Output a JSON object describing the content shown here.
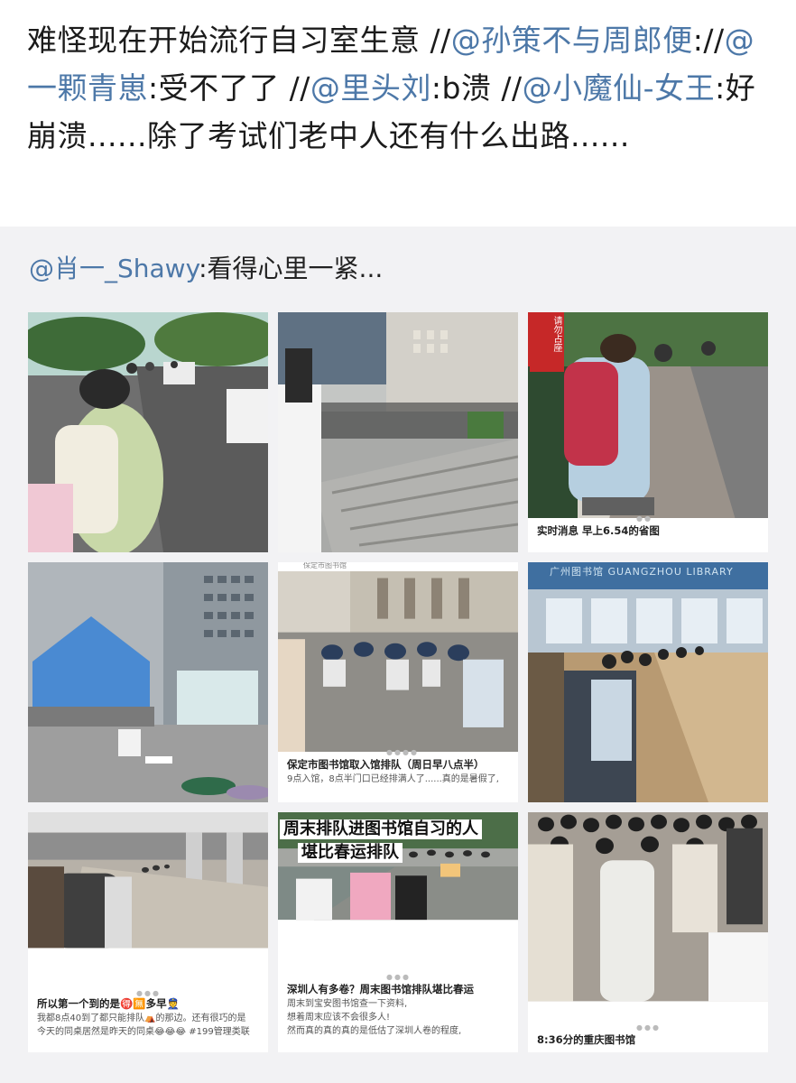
{
  "post": {
    "segments": [
      {
        "text": "难怪现在开始流行自习室生意 //",
        "mention": false
      },
      {
        "text": "@孙策不与周郎便",
        "mention": true
      },
      {
        "text": "://",
        "mention": false
      },
      {
        "text": "@一颗青崽",
        "mention": true
      },
      {
        "text": ":受不了了 //",
        "mention": false
      },
      {
        "text": "@里头刘",
        "mention": true
      },
      {
        "text": ":b溃 //",
        "mention": false
      },
      {
        "text": "@小魔仙-女王",
        "mention": true
      },
      {
        "text": ":好崩溃......除了考试们老中人还有什么出路......",
        "mention": false
      }
    ]
  },
  "repost": {
    "author": "@肖一_Shawy",
    "text": ":看得心里一紧..."
  },
  "photos": [
    {
      "id": "p1"
    },
    {
      "id": "p2"
    },
    {
      "id": "p3",
      "caption_title": "实时消息 早上6.54的省图",
      "caption_body": "",
      "banner": "请勿占座"
    },
    {
      "id": "p4"
    },
    {
      "id": "p5",
      "header": "保定市图书馆",
      "caption_title": "保定市图书馆取入馆排队（周日早八点半）",
      "caption_body": "9点入馆，8点半门口已经排满人了......真的是暑假了,"
    },
    {
      "id": "p6",
      "sign": "广州图书馆 GUANGZHOU LIBRARY"
    },
    {
      "id": "p7",
      "caption_title": "所以第一个到的是🉐🈚多早👮",
      "caption_body_1": "我都8点40到了都只能排队⛺的那边。还有很巧的是",
      "caption_body_2": "今天的同桌居然是昨天的同桌😂😂😂 #199管理类联"
    },
    {
      "id": "p8",
      "banner_1": "周末排队进图书馆自习的人",
      "banner_2": "堪比春运排队",
      "caption_title": "深圳人有多卷？周末图书馆排队堪比春运",
      "caption_body_1": "周末到宝安图书馆查一下资料,",
      "caption_body_2": "想着周末应该不会很多人!",
      "caption_body_3": "然而真的真的真的是低估了深圳人卷的程度,"
    },
    {
      "id": "p9",
      "caption_title": "8:36分的重庆图书馆"
    }
  ],
  "colors": {
    "mention": "#4d78a8",
    "repost_bg": "#f2f2f4",
    "text": "#1b1b1b"
  }
}
